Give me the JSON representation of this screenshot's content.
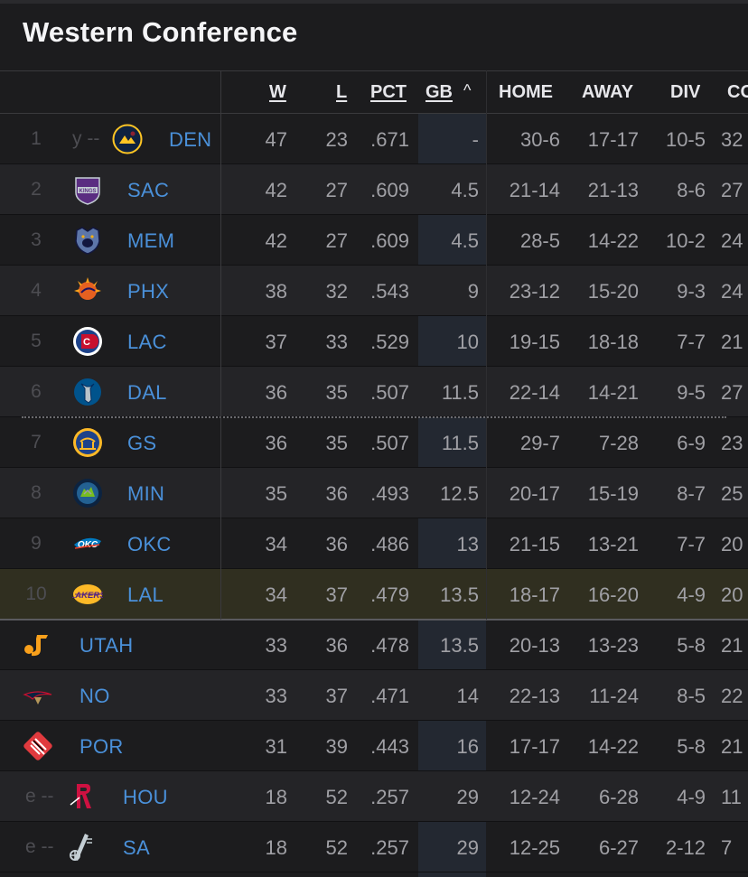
{
  "title": "Western Conference",
  "columns": {
    "w": "W",
    "l": "L",
    "pct": "PCT",
    "gb": "GB",
    "sort_arrow": "^",
    "home": "HOME",
    "away": "AWAY",
    "div": "DIV",
    "conf": "CO"
  },
  "colors": {
    "background": "#1c1c1e",
    "team_link": "#4a90d9",
    "highlight_row": "#302f20"
  },
  "teams": [
    {
      "rank": "1",
      "clinch": "y --",
      "abbr": "DEN",
      "icon": "nuggets-logo",
      "w": "47",
      "l": "23",
      "pct": ".671",
      "gb": "-",
      "home": "30-6",
      "away": "17-17",
      "div": "10-5",
      "conf": "32"
    },
    {
      "rank": "2",
      "clinch": "",
      "abbr": "SAC",
      "icon": "kings-logo",
      "w": "42",
      "l": "27",
      "pct": ".609",
      "gb": "4.5",
      "home": "21-14",
      "away": "21-13",
      "div": "8-6",
      "conf": "27"
    },
    {
      "rank": "3",
      "clinch": "",
      "abbr": "MEM",
      "icon": "grizzlies-logo",
      "w": "42",
      "l": "27",
      "pct": ".609",
      "gb": "4.5",
      "home": "28-5",
      "away": "14-22",
      "div": "10-2",
      "conf": "24"
    },
    {
      "rank": "4",
      "clinch": "",
      "abbr": "PHX",
      "icon": "suns-logo",
      "w": "38",
      "l": "32",
      "pct": ".543",
      "gb": "9",
      "home": "23-12",
      "away": "15-20",
      "div": "9-3",
      "conf": "24"
    },
    {
      "rank": "5",
      "clinch": "",
      "abbr": "LAC",
      "icon": "clippers-logo",
      "w": "37",
      "l": "33",
      "pct": ".529",
      "gb": "10",
      "home": "19-15",
      "away": "18-18",
      "div": "7-7",
      "conf": "21"
    },
    {
      "rank": "6",
      "clinch": "",
      "abbr": "DAL",
      "icon": "mavericks-logo",
      "w": "36",
      "l": "35",
      "pct": ".507",
      "gb": "11.5",
      "home": "22-14",
      "away": "14-21",
      "div": "9-5",
      "conf": "27"
    },
    {
      "rank": "7",
      "clinch": "",
      "abbr": "GS",
      "icon": "warriors-logo",
      "w": "36",
      "l": "35",
      "pct": ".507",
      "gb": "11.5",
      "home": "29-7",
      "away": "7-28",
      "div": "6-9",
      "conf": "23"
    },
    {
      "rank": "8",
      "clinch": "",
      "abbr": "MIN",
      "icon": "timberwolves-logo",
      "w": "35",
      "l": "36",
      "pct": ".493",
      "gb": "12.5",
      "home": "20-17",
      "away": "15-19",
      "div": "8-7",
      "conf": "25"
    },
    {
      "rank": "9",
      "clinch": "",
      "abbr": "OKC",
      "icon": "thunder-logo",
      "w": "34",
      "l": "36",
      "pct": ".486",
      "gb": "13",
      "home": "21-15",
      "away": "13-21",
      "div": "7-7",
      "conf": "20"
    },
    {
      "rank": "10",
      "clinch": "",
      "abbr": "LAL",
      "icon": "lakers-logo",
      "w": "34",
      "l": "37",
      "pct": ".479",
      "gb": "13.5",
      "home": "18-17",
      "away": "16-20",
      "div": "4-9",
      "conf": "20"
    },
    {
      "rank": "",
      "clinch": "",
      "abbr": "UTAH",
      "icon": "jazz-logo",
      "w": "33",
      "l": "36",
      "pct": ".478",
      "gb": "13.5",
      "home": "20-13",
      "away": "13-23",
      "div": "5-8",
      "conf": "21"
    },
    {
      "rank": "",
      "clinch": "",
      "abbr": "NO",
      "icon": "pelicans-logo",
      "w": "33",
      "l": "37",
      "pct": ".471",
      "gb": "14",
      "home": "22-13",
      "away": "11-24",
      "div": "8-5",
      "conf": "22"
    },
    {
      "rank": "",
      "clinch": "",
      "abbr": "POR",
      "icon": "trail-blazers-logo",
      "w": "31",
      "l": "39",
      "pct": ".443",
      "gb": "16",
      "home": "17-17",
      "away": "14-22",
      "div": "5-8",
      "conf": "21"
    },
    {
      "rank": "",
      "clinch": "e --",
      "abbr": "HOU",
      "icon": "rockets-logo",
      "w": "18",
      "l": "52",
      "pct": ".257",
      "gb": "29",
      "home": "12-24",
      "away": "6-28",
      "div": "4-9",
      "conf": "11"
    },
    {
      "rank": "",
      "clinch": "e --",
      "abbr": "SA",
      "icon": "spurs-logo",
      "w": "18",
      "l": "52",
      "pct": ".257",
      "gb": "29",
      "home": "12-25",
      "away": "6-27",
      "div": "2-12",
      "conf": "7"
    }
  ]
}
